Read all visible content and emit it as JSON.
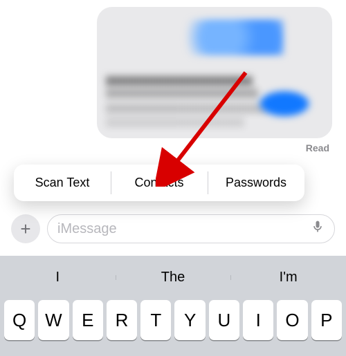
{
  "conversation": {
    "read_receipt": "Read"
  },
  "context_menu": {
    "items": [
      {
        "label": "Scan Text"
      },
      {
        "label": "Contacts"
      },
      {
        "label": "Passwords"
      }
    ]
  },
  "compose": {
    "add_button_label": "+",
    "placeholder": "iMessage"
  },
  "keyboard": {
    "suggestions": [
      "I",
      "The",
      "I'm"
    ],
    "row1": [
      "Q",
      "W",
      "E",
      "R",
      "T",
      "Y",
      "U",
      "I",
      "O",
      "P"
    ]
  }
}
